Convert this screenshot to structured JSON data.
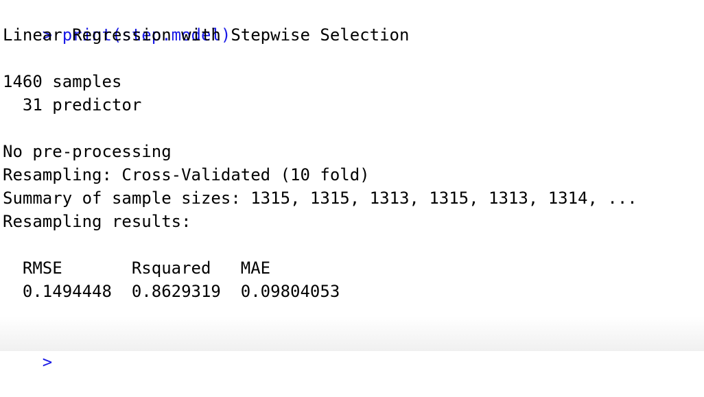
{
  "console": {
    "command_prompt": ">",
    "command_text": "print(step.model)",
    "title": "Linear Regression with Stepwise Selection",
    "samples_line": "1460 samples",
    "predictors_line": "  31 predictor",
    "preprocessing": "No pre-processing",
    "resampling": "Resampling: Cross-Validated (10 fold)",
    "sample_sizes": "Summary of sample sizes: 1315, 1315, 1313, 1315, 1313, 1314, ...",
    "results_header": "Resampling results:",
    "metrics_header": "  RMSE       Rsquared   MAE       ",
    "metrics_values": "  0.1494448  0.8629319  0.09804053",
    "input_prompt": ">"
  },
  "colors": {
    "prompt": "#1a1ae6",
    "text": "#000000",
    "background": "#ffffff"
  }
}
